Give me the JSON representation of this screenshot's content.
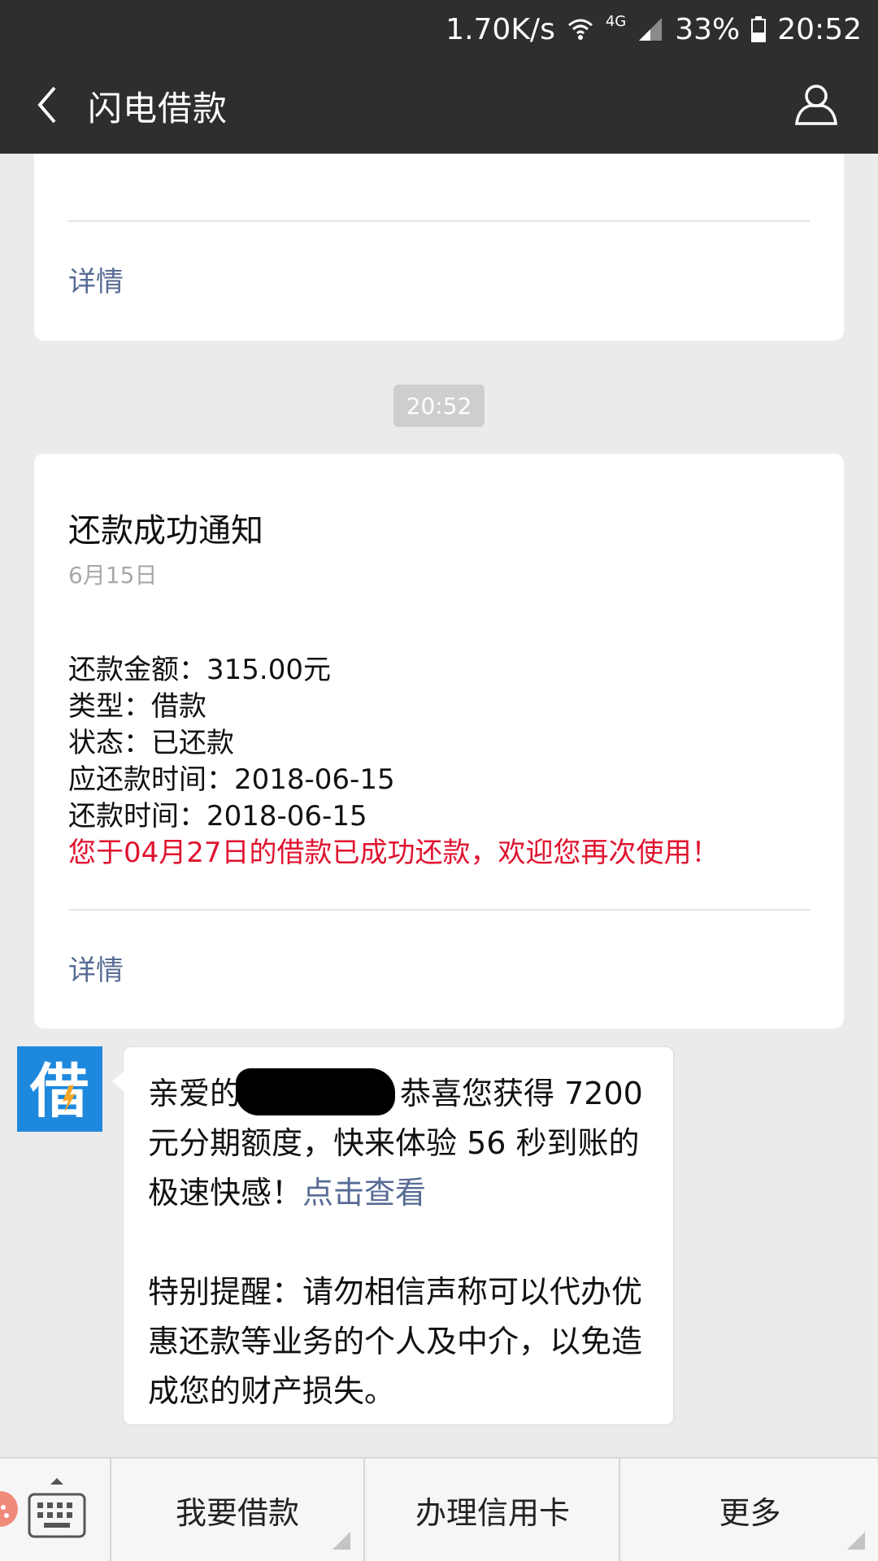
{
  "status_bar": {
    "speed": "1.70K/s",
    "network": "4G",
    "battery": "33%",
    "time": "20:52"
  },
  "header": {
    "title": "闪电借款"
  },
  "top_card": {
    "detail_label": "详情"
  },
  "time_badge": "20:52",
  "notice_card": {
    "title": "还款成功通知",
    "date": "6月15日",
    "lines": [
      "还款金额：315.00元",
      "类型：借款",
      "状态：已还款",
      "应还款时间：2018-06-15",
      "还款时间：2018-06-15"
    ],
    "highlight": "您于04月27日的借款已成功还款，欢迎您再次使用！",
    "detail_label": "详情"
  },
  "message": {
    "avatar_char": "借",
    "greeting_prefix": "亲爱的",
    "text_after_redaction": "恭喜您获得 7200 元分期额度，快来体验 56 秒到账的极速快感！",
    "link_text": "点击查看",
    "reminder": "特别提醒：请勿相信声称可以代办优惠还款等业务的个人及中介，以免造成您的财产损失。"
  },
  "bottom_menu": {
    "items": [
      "我要借款",
      "办理信用卡",
      "更多"
    ]
  },
  "colors": {
    "header_bg": "#2e2e2e",
    "link": "#576b95",
    "highlight_red": "#e0132f",
    "avatar_bg": "#1e88dd"
  },
  "icons": [
    "back-arrow-icon",
    "profile-icon",
    "wifi-icon",
    "signal-icon",
    "battery-icon",
    "keyboard-icon"
  ]
}
